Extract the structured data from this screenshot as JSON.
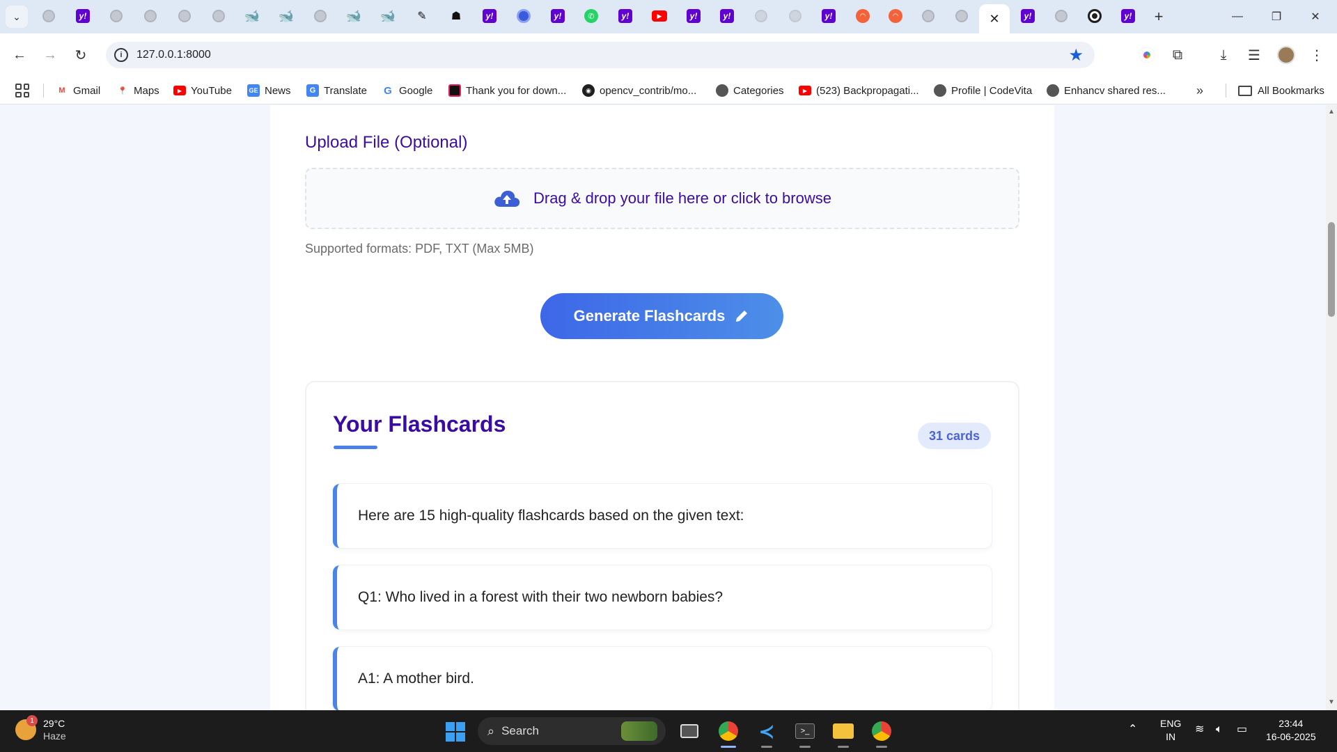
{
  "browser": {
    "url": "127.0.0.1:8000",
    "bookmarks": [
      {
        "label": "Gmail",
        "icon": "gmail-icon"
      },
      {
        "label": "Maps",
        "icon": "maps-icon"
      },
      {
        "label": "YouTube",
        "icon": "youtube-icon"
      },
      {
        "label": "News",
        "icon": "news-icon"
      },
      {
        "label": "Translate",
        "icon": "translate-icon"
      },
      {
        "label": "Google",
        "icon": "google-icon"
      },
      {
        "label": "Thank you for down...",
        "icon": "app-icon"
      },
      {
        "label": "opencv_contrib/mo...",
        "icon": "github-icon"
      },
      {
        "label": "Categories",
        "icon": "globe-icon"
      },
      {
        "label": "(523) Backpropagati...",
        "icon": "youtube-icon"
      },
      {
        "label": "Profile | CodeVita",
        "icon": "globe-icon"
      },
      {
        "label": "Enhancv shared res...",
        "icon": "globe-icon"
      }
    ],
    "all_bookmarks": "All Bookmarks"
  },
  "page": {
    "upload_label": "Upload File (Optional)",
    "dropzone_text": "Drag & drop your file here or click to browse",
    "supported_formats": "Supported formats: PDF, TXT (Max 5MB)",
    "generate_button": "Generate Flashcards",
    "flashcards": {
      "title": "Your Flashcards",
      "count": "31 cards",
      "cards": [
        "Here are 15 high-quality flashcards based on the given text:",
        "Q1: Who lived in a forest with their two newborn babies?",
        "A1: A mother bird."
      ]
    }
  },
  "taskbar": {
    "weather_temp": "29°C",
    "weather_desc": "Haze",
    "weather_badge": "1",
    "search_placeholder": "Search",
    "lang_top": "ENG",
    "lang_bottom": "IN",
    "time": "23:44",
    "date": "16-06-2025"
  },
  "colors": {
    "accent": "#3a0ca3",
    "button_gradient_start": "#3d67e8",
    "button_gradient_end": "#4d8fe8",
    "card_border": "#4a85e6"
  }
}
